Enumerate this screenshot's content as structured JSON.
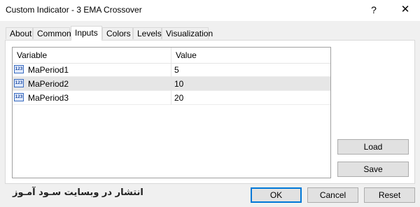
{
  "window": {
    "title": "Custom Indicator - 3 EMA Crossover",
    "help_glyph": "?",
    "close_glyph": "✕"
  },
  "tabs": [
    {
      "label": "About"
    },
    {
      "label": "Common"
    },
    {
      "label": "Inputs",
      "active": true
    },
    {
      "label": "Colors"
    },
    {
      "label": "Levels"
    },
    {
      "label": "Visualization"
    }
  ],
  "grid": {
    "headers": {
      "variable": "Variable",
      "value": "Value"
    },
    "rows": [
      {
        "name": "MaPeriod1",
        "value": "5",
        "icon": "integer-icon",
        "icon_text": "123"
      },
      {
        "name": "MaPeriod2",
        "value": "10",
        "icon": "integer-icon",
        "icon_text": "123",
        "selected": true
      },
      {
        "name": "MaPeriod3",
        "value": "20",
        "icon": "integer-icon",
        "icon_text": "123"
      }
    ]
  },
  "buttons": {
    "load": "Load",
    "save": "Save",
    "ok": "OK",
    "cancel": "Cancel",
    "reset": "Reset"
  },
  "footer": {
    "watermark": "انتشار در وبسایت سـود آمـوز"
  }
}
